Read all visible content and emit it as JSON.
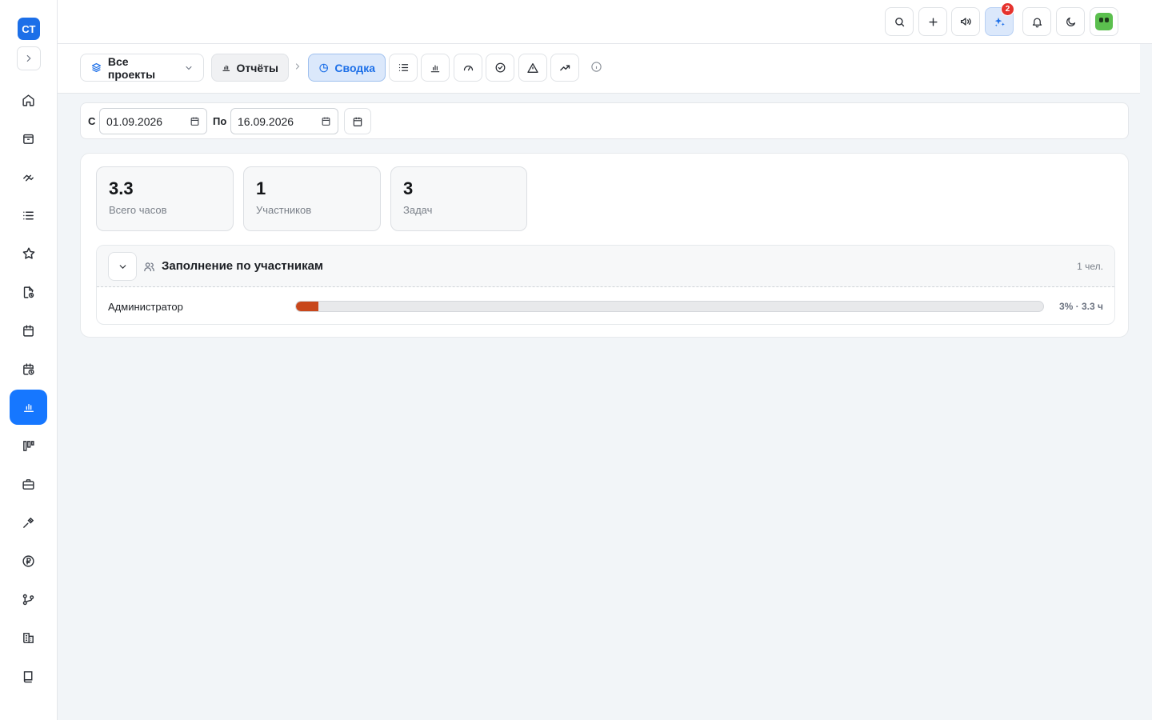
{
  "sidebar": {
    "logo_text": "СТ",
    "items": [
      {
        "icon": "home-icon"
      },
      {
        "icon": "inbox-icon"
      },
      {
        "icon": "handshake-icon"
      },
      {
        "icon": "list-icon"
      },
      {
        "icon": "star-icon"
      },
      {
        "icon": "document-clock-icon"
      },
      {
        "icon": "calendar-icon"
      },
      {
        "icon": "calendar-clock-icon"
      },
      {
        "icon": "reports-chart-icon",
        "active": true
      },
      {
        "icon": "kanban-icon"
      },
      {
        "icon": "briefcase-icon"
      },
      {
        "icon": "tools-icon"
      },
      {
        "icon": "ruble-icon"
      },
      {
        "icon": "git-branch-icon"
      },
      {
        "icon": "building-icon"
      },
      {
        "icon": "book-icon"
      }
    ]
  },
  "topbar": {
    "ai_badge": "2"
  },
  "toolbar": {
    "projects_label": "Все проекты",
    "reports_label": "Отчёты",
    "summary_label": "Сводка"
  },
  "filter": {
    "from_label": "С",
    "from_value": "01.09.2026",
    "to_label": "По",
    "to_value": "16.09.2026"
  },
  "stats": [
    {
      "value": "3.3",
      "label": "Всего часов"
    },
    {
      "value": "1",
      "label": "Участников"
    },
    {
      "value": "3",
      "label": "Задач"
    }
  ],
  "participants": {
    "title": "Заполнение по участникам",
    "count": "1 чел.",
    "rows": [
      {
        "name": "Администратор",
        "percent": 3,
        "value": "3% · 3.3 ч"
      }
    ]
  },
  "colors": {
    "accent": "#1677ff",
    "bar_fill": "#c8471b",
    "badge": "#e5322d"
  }
}
